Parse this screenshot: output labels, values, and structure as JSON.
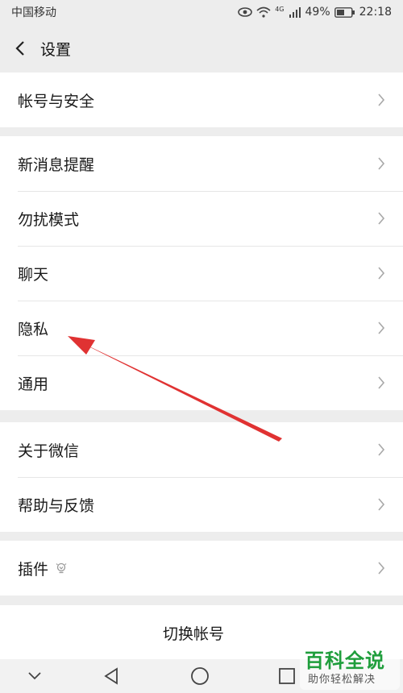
{
  "status": {
    "carrier": "中国移动",
    "battery": "49%",
    "time": "22:18",
    "network": "4G"
  },
  "header": {
    "title": "设置"
  },
  "groups": [
    {
      "items": [
        {
          "label": "帐号与安全"
        }
      ]
    },
    {
      "items": [
        {
          "label": "新消息提醒"
        },
        {
          "label": "勿扰模式"
        },
        {
          "label": "聊天"
        },
        {
          "label": "隐私"
        },
        {
          "label": "通用"
        }
      ]
    },
    {
      "items": [
        {
          "label": "关于微信"
        },
        {
          "label": "帮助与反馈"
        }
      ]
    },
    {
      "items": [
        {
          "label": "插件"
        }
      ]
    }
  ],
  "switch_account": {
    "label": "切换帐号"
  },
  "watermark": {
    "title": "百科全说",
    "subtitle": "助你轻松解决"
  },
  "colors": {
    "background": "#ededed",
    "arrow": "#e03232",
    "watermark": "#1f9e3c"
  }
}
